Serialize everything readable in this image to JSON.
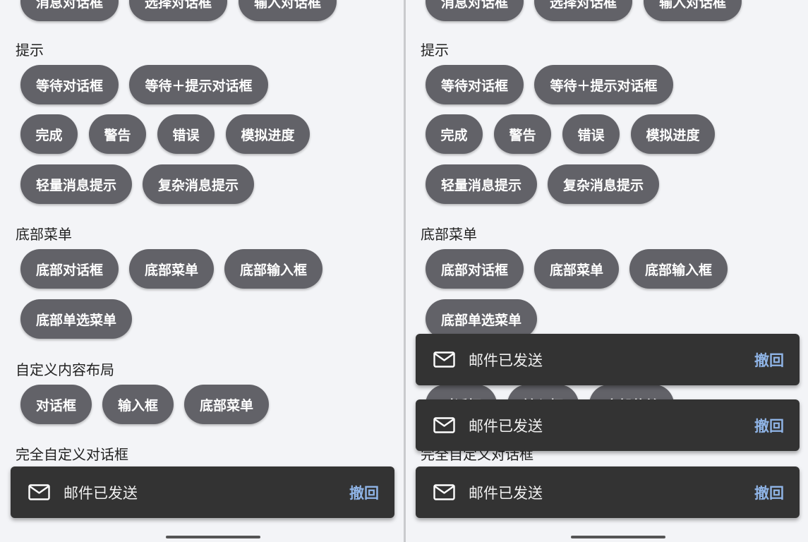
{
  "buttons": {
    "message_dialog": "消息对话框",
    "select_dialog": "选择对话框",
    "input_dialog": "输入对话框",
    "wait_dialog": "等待对话框",
    "wait_tip_dialog": "等待＋提示对话框",
    "done": "完成",
    "warning": "警告",
    "error": "错误",
    "simulate_progress": "模拟进度",
    "light_tip": "轻量消息提示",
    "complex_tip": "复杂消息提示",
    "bottom_dialog": "底部对话框",
    "bottom_menu": "底部菜单",
    "bottom_input": "底部输入框",
    "bottom_single_select": "底部单选菜单",
    "custom_dialog": "对话框",
    "custom_input": "输入框",
    "custom_bottom_menu": "底部菜单"
  },
  "sections": {
    "tips": "提示",
    "bottom_menu": "底部菜单",
    "custom_layout": "自定义内容布局",
    "full_custom": "完全自定义对话框"
  },
  "snackbar": {
    "icon": "mail-icon",
    "message": "邮件已发送",
    "action": "撤回",
    "bg_color": "#333333",
    "action_color": "#8fb4e6"
  },
  "colors": {
    "button_bg": "#626268",
    "page_bg": "#f3f4f7"
  }
}
